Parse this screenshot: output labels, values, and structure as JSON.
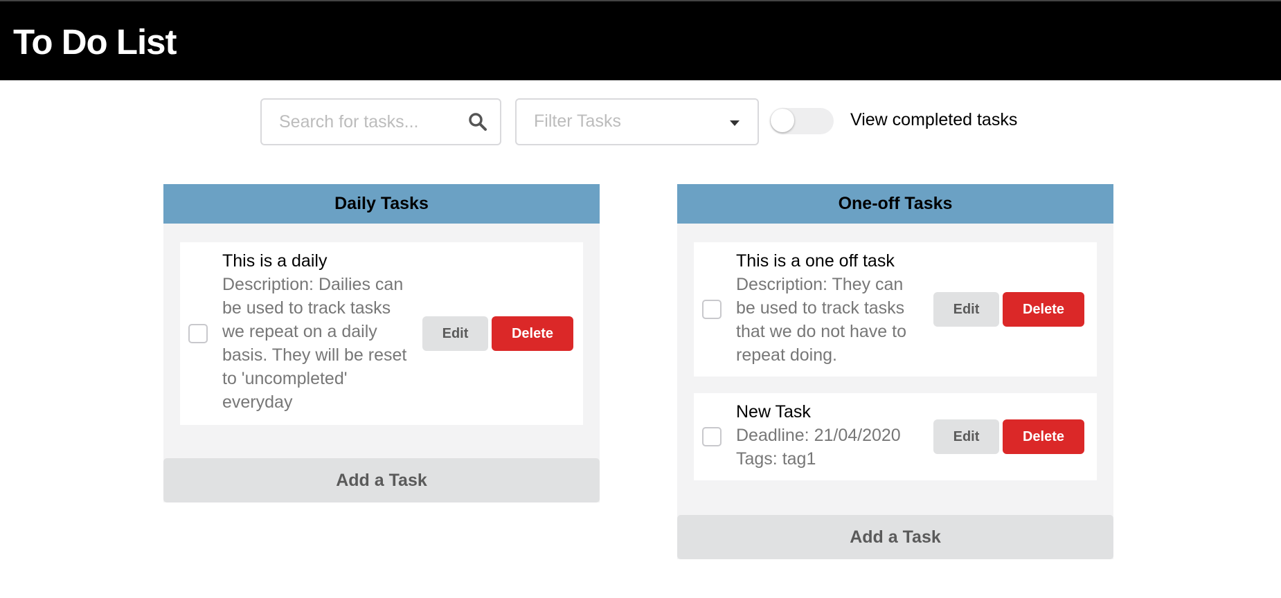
{
  "header": {
    "title": "To Do List"
  },
  "toolbar": {
    "search_placeholder": "Search for tasks...",
    "filter_placeholder": "Filter Tasks",
    "toggle_label": "View completed tasks",
    "toggle_on": false
  },
  "daily": {
    "title": "Daily Tasks",
    "tasks": [
      {
        "title": "This is a daily",
        "detail": "Description: Dailies can be used to track tasks we repeat on a daily basis. They will be reset to 'uncompleted' everyday",
        "completed": false
      }
    ],
    "add_label": "Add a Task"
  },
  "oneoff": {
    "title": "One-off Tasks",
    "tasks": [
      {
        "title": "This is a one off task",
        "detail": "Description: They can be used to track tasks that we do not have to repeat doing.",
        "completed": false
      },
      {
        "title": "New Task",
        "deadline": "Deadline: 21/04/2020",
        "tags": "Tags: tag1",
        "completed": false
      }
    ],
    "add_label": "Add a Task"
  },
  "buttons": {
    "edit": "Edit",
    "delete": "Delete"
  },
  "colors": {
    "header_bg": "#000000",
    "column_header": "#6ba1c4",
    "delete_red": "#db2828",
    "neutral_button": "#e0e1e2"
  }
}
